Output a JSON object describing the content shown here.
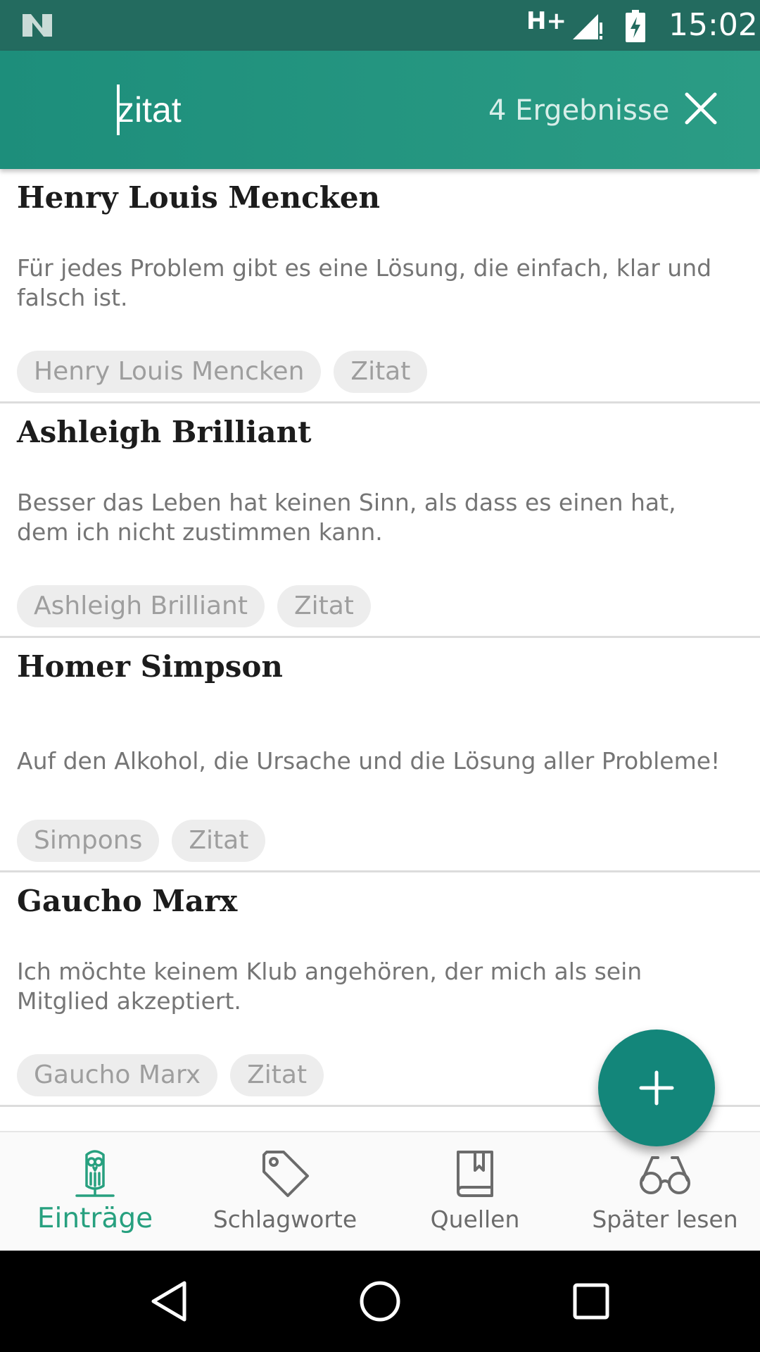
{
  "status_bar": {
    "network": "H+",
    "time": "15:02"
  },
  "search": {
    "query": "zitat",
    "result_count": "4 Ergebnisse"
  },
  "entries": [
    {
      "title": "Henry Louis Mencken",
      "quote": "Für jedes Problem gibt es eine Lösung, die einfach, klar und falsch ist.",
      "tags": [
        "Henry Louis Mencken",
        "Zitat"
      ]
    },
    {
      "title": "Ashleigh Brilliant",
      "quote": "Besser das Leben hat keinen Sinn, als dass es einen hat, dem ich nicht zustimmen kann.",
      "tags": [
        "Ashleigh Brilliant",
        "Zitat"
      ]
    },
    {
      "title": "Homer Simpson",
      "quote": "Auf den Alkohol, die Ursache und die Lösung aller Probleme!",
      "tags": [
        "Simpons",
        "Zitat"
      ]
    },
    {
      "title": "Gaucho Marx",
      "quote": "Ich möchte keinem Klub angehören, der mich als sein Mitglied akzeptiert.",
      "tags": [
        "Gaucho Marx",
        "Zitat"
      ]
    }
  ],
  "bottom_nav": [
    {
      "label": "Einträge",
      "icon": "owl-icon",
      "active": true
    },
    {
      "label": "Schlagworte",
      "icon": "tag-icon",
      "active": false
    },
    {
      "label": "Quellen",
      "icon": "book-icon",
      "active": false
    },
    {
      "label": "Später lesen",
      "icon": "glasses-icon",
      "active": false
    }
  ],
  "colors": {
    "status_bar": "#236b5f",
    "toolbar": "#1d8e7b",
    "accent": "#13867a",
    "active_nav": "#27a07f"
  }
}
